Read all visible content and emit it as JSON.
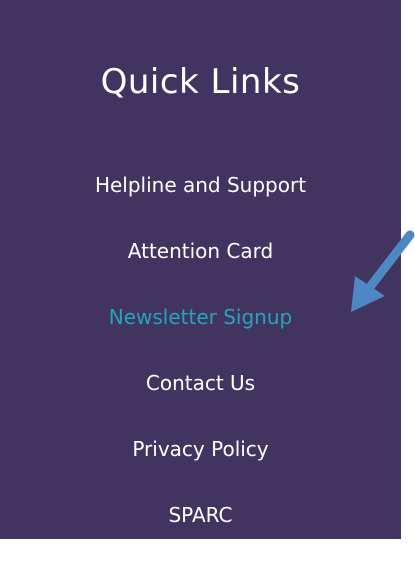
{
  "quick_links": {
    "title": "Quick Links",
    "items": [
      {
        "label": "Helpline and Support"
      },
      {
        "label": "Attention Card"
      },
      {
        "label": "Newsletter Signup"
      },
      {
        "label": "Contact Us"
      },
      {
        "label": "Privacy Policy"
      },
      {
        "label": "SPARC"
      }
    ]
  },
  "colors": {
    "panel_background": "#413461",
    "text": "#ffffff",
    "highlight": "#27a4b6",
    "arrow": "#4f86c4"
  },
  "icons": {
    "pointer": "arrow-pointer-icon"
  }
}
